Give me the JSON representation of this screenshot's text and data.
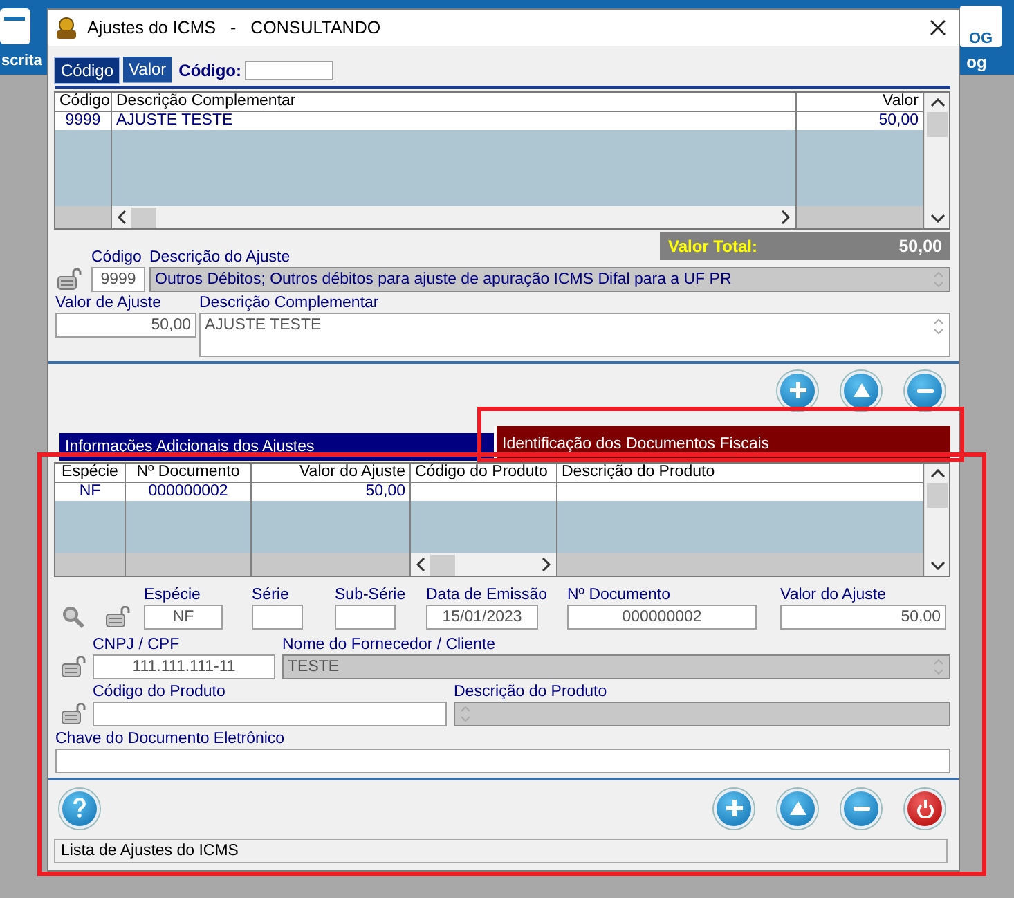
{
  "desktop": {
    "icons": [
      {
        "label": "scrita"
      },
      {
        "label": "og",
        "badge": "OG"
      }
    ]
  },
  "window": {
    "title": "Ajustes do ICMS   -   CONSULTANDO"
  },
  "order_tabs": [
    {
      "label": "Código",
      "selected": true
    },
    {
      "label": "Valor",
      "selected": false
    }
  ],
  "search": {
    "label": "Código:"
  },
  "adjustments_table": {
    "columns": [
      "Código",
      "Descrição Complementar",
      "Valor"
    ],
    "rows": [
      [
        "9999",
        "AJUSTE TESTE",
        "50,00"
      ]
    ]
  },
  "total": {
    "label": "Valor Total:",
    "value": "50,00"
  },
  "adjustment_fields": [
    {
      "lookup_button": true,
      "fields": [
        {
          "label": "Código",
          "value": "9999",
          "kind": "centered",
          "disabled": false
        },
        {
          "label": "Descrição do Ajuste",
          "value": "Outros Débitos; Outros débitos para ajuste de apuração ICMS Difal para a UF PR",
          "kind": "memo",
          "disabled": true
        }
      ]
    },
    {
      "fields": [
        {
          "label": "Valor de Ajuste",
          "value": "50,00",
          "kind": "numeric",
          "disabled": false
        },
        {
          "label": "Descrição Complementar",
          "value": "AJUSTE TESTE",
          "kind": "memo-tall",
          "disabled": false
        }
      ]
    }
  ],
  "action_buttons": [
    {
      "kind": "add"
    },
    {
      "kind": "up"
    },
    {
      "kind": "remove"
    }
  ],
  "section_tabs": [
    {
      "label": "Informações Adicionais dos Ajustes",
      "selected": false
    },
    {
      "label": "Identificação dos Documentos Fiscais",
      "selected": true
    }
  ],
  "documents_table": {
    "columns": [
      "Espécie",
      "Nº Documento",
      "Valor do Ajuste",
      "Código do Produto",
      "Descrição do Produto"
    ],
    "rows": [
      [
        "NF",
        "000000002",
        "50,00"
      ]
    ]
  },
  "document_fields": [
    {
      "search_button": true,
      "lookup_button": true,
      "fields": [
        {
          "label": "Espécie",
          "value": "NF",
          "kind": "centered",
          "disabled": false
        },
        {
          "label": "Série",
          "kind": "centered",
          "disabled": false
        },
        {
          "label": "Sub-Série",
          "kind": "centered",
          "disabled": false
        },
        {
          "label": "Data de Emissão",
          "value": "15/01/2023",
          "kind": "centered",
          "disabled": false
        },
        {
          "label": "Nº Documento",
          "value": "000000002",
          "kind": "centered",
          "disabled": false
        },
        {
          "label": "Valor do Ajuste",
          "value": "50,00",
          "kind": "numeric",
          "disabled": false
        }
      ]
    },
    {
      "lookup_button": true,
      "fields": [
        {
          "label": "CNPJ / CPF",
          "value": "111.111.111-11",
          "kind": "centered",
          "disabled": false
        },
        {
          "label": "Nome do Fornecedor / Cliente",
          "value": "TESTE",
          "kind": "memo",
          "disabled": true
        }
      ]
    },
    {
      "lookup_button": true,
      "fields": [
        {
          "label": "Código do Produto",
          "kind": "text",
          "disabled": false
        },
        {
          "label": "Descrição do Produto",
          "kind": "memo",
          "disabled": true
        }
      ]
    },
    {
      "fields": [
        {
          "label": "Chave do Documento Eletrônico",
          "kind": "text",
          "disabled": false
        }
      ]
    }
  ],
  "bottom_buttons": [
    {
      "kind": "help"
    },
    {
      "kind": "add"
    },
    {
      "kind": "up"
    },
    {
      "kind": "remove"
    },
    {
      "kind": "power"
    }
  ],
  "status_bar": {
    "text": "Lista de Ajustes do ICMS"
  },
  "annotations": [
    {
      "kind": "rectangle"
    },
    {
      "kind": "rectangle"
    }
  ]
}
